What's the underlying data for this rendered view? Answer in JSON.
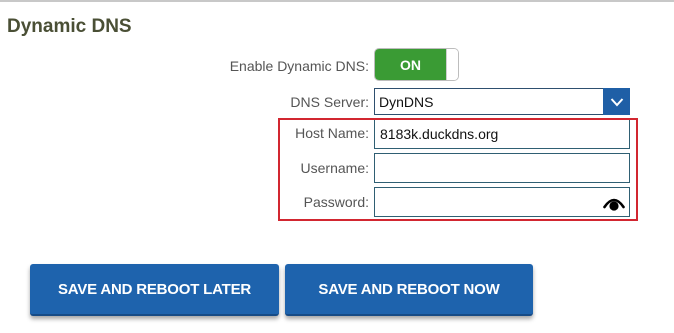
{
  "section": {
    "title": "Dynamic DNS"
  },
  "form": {
    "enable_label": "Enable Dynamic DNS:",
    "enable_toggle": {
      "state_label": "ON",
      "checked": true
    },
    "dns_server_label": "DNS Server:",
    "dns_server_value": "DynDNS",
    "host_name_label": "Host Name:",
    "host_name_value": "8183k.duckdns.org",
    "username_label": "Username:",
    "username_value": "",
    "password_label": "Password:",
    "password_value": ""
  },
  "buttons": {
    "save_later": "SAVE AND REBOOT LATER",
    "save_now": "SAVE AND REBOOT NOW"
  },
  "icons": {
    "dropdown": "chevron-down-icon",
    "password_reveal": "eye-icon"
  },
  "colors": {
    "title": "#4a4f35",
    "toggle_on": "#3a9b34",
    "primary_button": "#1e63ad",
    "highlight": "#d22630"
  }
}
